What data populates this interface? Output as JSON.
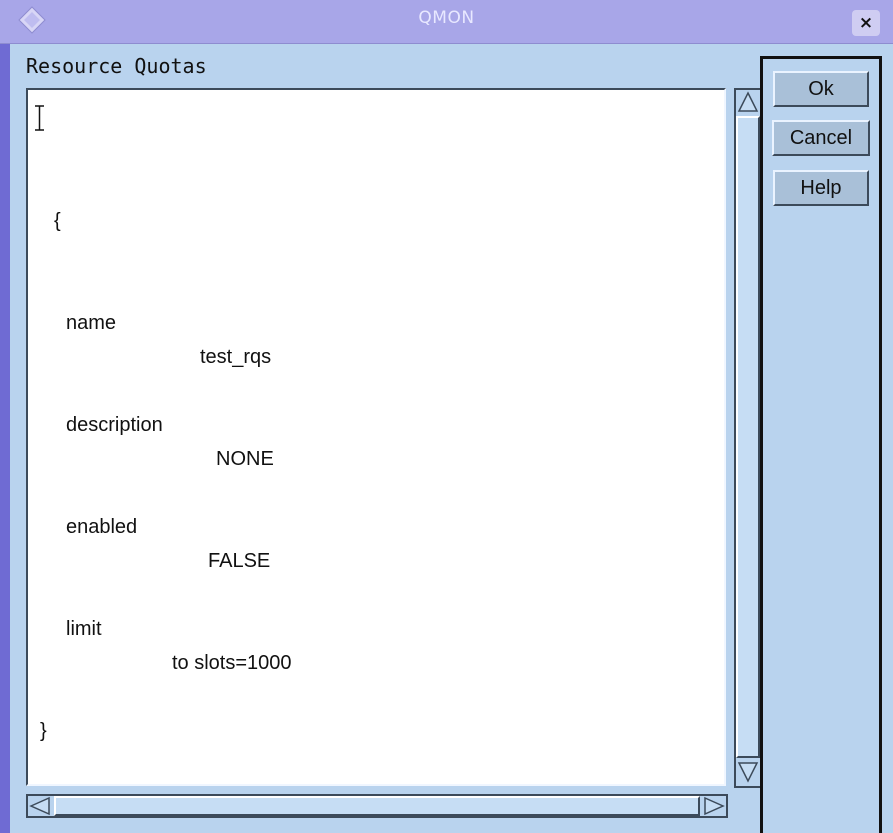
{
  "window": {
    "title": "QMON",
    "close_label": "×"
  },
  "main": {
    "label": "Resource Quotas",
    "editor": {
      "open_brace": "{",
      "lines": [
        {
          "key": "name",
          "value": "test_rqs"
        },
        {
          "key": "description",
          "value": "NONE"
        },
        {
          "key": "enabled",
          "value": "FALSE"
        },
        {
          "key": "limit",
          "value": "to slots=1000"
        }
      ],
      "close_brace": "}"
    }
  },
  "buttons": {
    "ok": "Ok",
    "cancel": "Cancel",
    "help": "Help"
  },
  "colors": {
    "background": "#b9d3ee",
    "titlebar": "#a8a6e8",
    "editor_bg": "#ffffff"
  }
}
